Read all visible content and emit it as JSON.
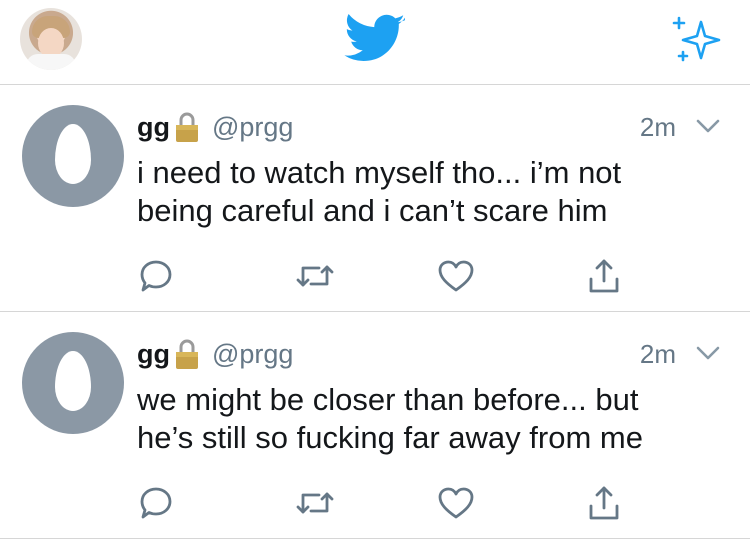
{
  "nav": {
    "profile_avatar": "user-avatar-photo",
    "logo": "twitter-bird-icon",
    "action": "sparkle-icon"
  },
  "tweets": [
    {
      "name": "gg",
      "handle": "@prgg",
      "time": "2m",
      "text": "i need to watch myself tho... i’m not being careful and i can’t scare him"
    },
    {
      "name": "gg",
      "handle": "@prgg",
      "time": "2m",
      "text": "we might be closer than before... but he’s still so fucking far away from me"
    }
  ],
  "colors": {
    "brand": "#1da1f2",
    "icon_gray": "#657786",
    "avatar_default": "#8b98a5",
    "lock": "#c7a24a"
  }
}
